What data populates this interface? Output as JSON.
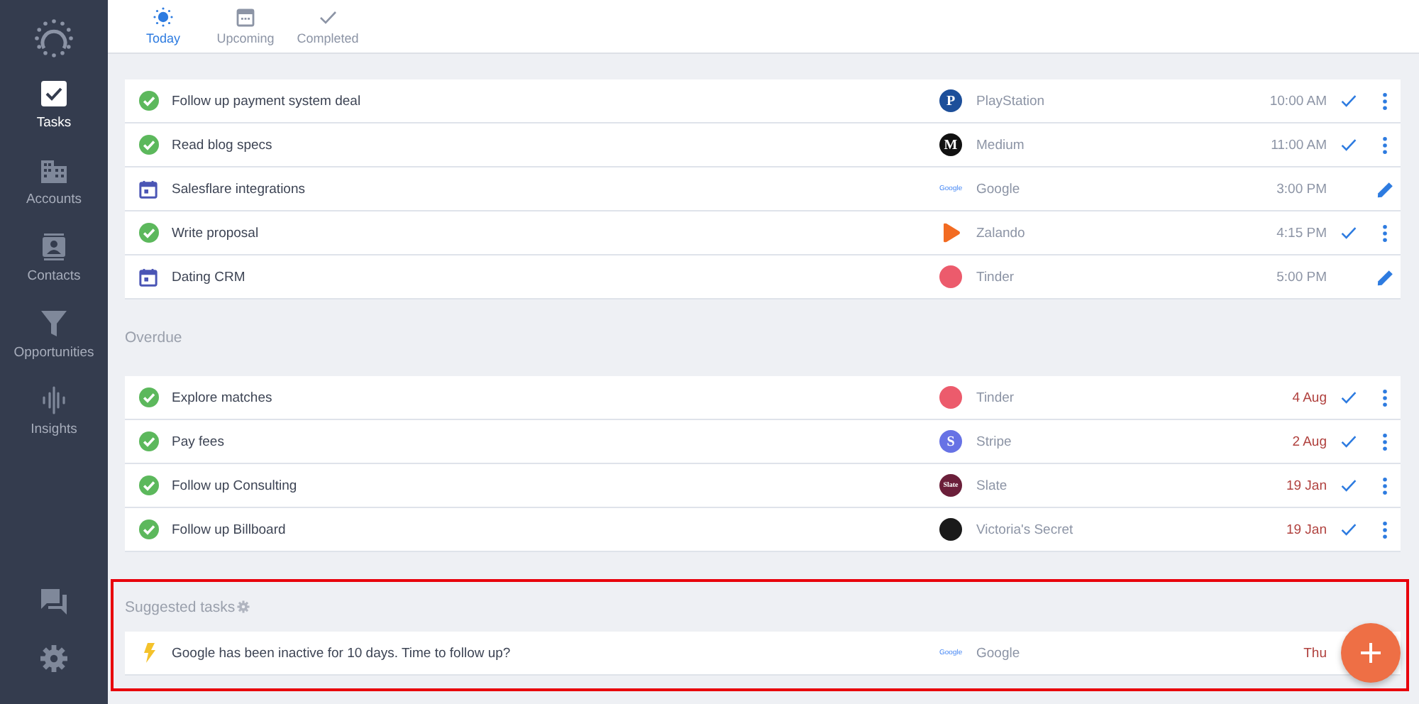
{
  "sidebar": {
    "items": [
      {
        "label": "Tasks",
        "selected": true
      },
      {
        "label": "Accounts",
        "selected": false
      },
      {
        "label": "Contacts",
        "selected": false
      },
      {
        "label": "Opportunities",
        "selected": false
      },
      {
        "label": "Insights",
        "selected": false
      }
    ]
  },
  "tabs": [
    {
      "label": "Today",
      "selected": true
    },
    {
      "label": "Upcoming",
      "selected": false
    },
    {
      "label": "Completed",
      "selected": false
    }
  ],
  "today": {
    "rows": [
      {
        "kind": "task",
        "title": "Follow up payment system deal",
        "company": "PlayStation",
        "logo": {
          "kind": "circle",
          "color": "#1d4f9a",
          "text": "P"
        },
        "time": "10:00 AM",
        "overdue": false
      },
      {
        "kind": "task",
        "title": "Read blog specs",
        "company": "Medium",
        "logo": {
          "kind": "circle",
          "color": "#111111",
          "text": "M"
        },
        "time": "11:00 AM",
        "overdue": false
      },
      {
        "kind": "meeting",
        "title": "Salesflare integrations",
        "company": "Google",
        "logo": {
          "kind": "wordmark",
          "text": "Google"
        },
        "time": "3:00 PM",
        "overdue": false
      },
      {
        "kind": "task",
        "title": "Write proposal",
        "company": "Zalando",
        "logo": {
          "kind": "play",
          "color": "#f26b22"
        },
        "time": "4:15 PM",
        "overdue": false
      },
      {
        "kind": "meeting",
        "title": "Dating CRM",
        "company": "Tinder",
        "logo": {
          "kind": "circle",
          "color": "#ec5b6c"
        },
        "time": "5:00 PM",
        "overdue": false
      }
    ]
  },
  "overdue": {
    "title": "Overdue",
    "rows": [
      {
        "kind": "task",
        "title": "Explore matches",
        "company": "Tinder",
        "logo": {
          "kind": "circle",
          "color": "#ec5b6c"
        },
        "time": "4 Aug",
        "overdue": true
      },
      {
        "kind": "task",
        "title": "Pay fees",
        "company": "Stripe",
        "logo": {
          "kind": "circle",
          "color": "#6772e5",
          "text": "S"
        },
        "time": "2 Aug",
        "overdue": true
      },
      {
        "kind": "task",
        "title": "Follow up Consulting",
        "company": "Slate",
        "logo": {
          "kind": "circle",
          "color": "#6b1f3a",
          "text": "Slate"
        },
        "time": "19 Jan",
        "overdue": true
      },
      {
        "kind": "task",
        "title": "Follow up Billboard",
        "company": "Victoria's Secret",
        "logo": {
          "kind": "circle",
          "color": "#1a1a1a"
        },
        "time": "19 Jan",
        "overdue": true
      }
    ]
  },
  "suggested": {
    "title": "Suggested tasks",
    "highlighted": true,
    "rows": [
      {
        "kind": "suggestion",
        "title": "Google has been inactive for 10 days. Time to follow up?",
        "company": "Google",
        "logo": {
          "kind": "wordmark",
          "text": "Google"
        },
        "time": "Thu",
        "overdue": true
      }
    ]
  }
}
